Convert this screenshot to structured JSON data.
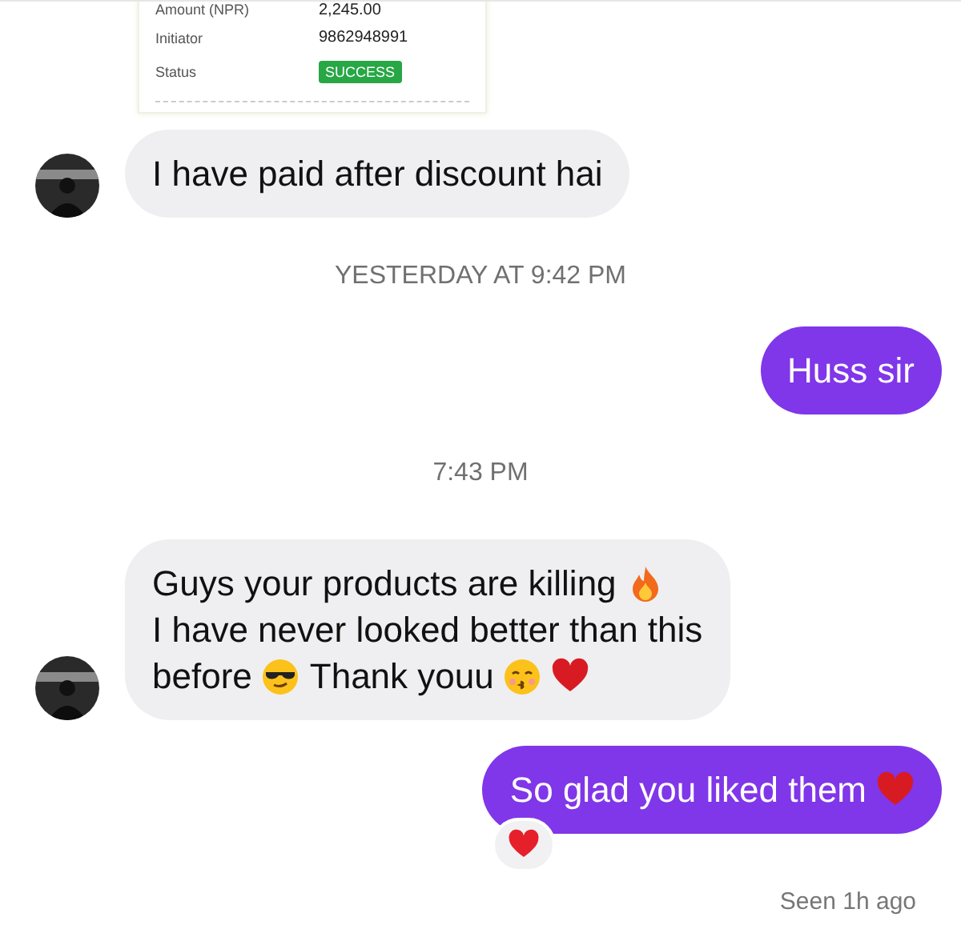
{
  "receipt": {
    "rows": [
      {
        "label": "Amount (NPR)",
        "value": "2,245.00",
        "kind": "text"
      },
      {
        "label": "Initiator",
        "value": "9862948991",
        "kind": "text"
      },
      {
        "label": "Status",
        "value": "SUCCESS",
        "kind": "badge"
      }
    ]
  },
  "thread": [
    {
      "kind": "incoming",
      "avatar": true,
      "lines": [
        [
          {
            "kind": "text",
            "text": "I have paid after discount hai"
          }
        ]
      ]
    },
    {
      "kind": "timestamp",
      "text": "YESTERDAY AT 9:42 PM"
    },
    {
      "kind": "outgoing",
      "lines": [
        [
          {
            "kind": "text",
            "text": "Huss sir"
          }
        ]
      ]
    },
    {
      "kind": "timestamp",
      "text": "7:43 PM"
    },
    {
      "kind": "incoming",
      "avatar": true,
      "lines": [
        [
          {
            "kind": "text",
            "text": "Guys your products are killing"
          },
          {
            "kind": "fire"
          }
        ],
        [
          {
            "kind": "text",
            "text": "I have never looked better than this"
          }
        ],
        [
          {
            "kind": "text",
            "text": "before"
          },
          {
            "kind": "cool"
          },
          {
            "kind": "text",
            "text": "Thank youu"
          },
          {
            "kind": "kiss"
          },
          {
            "kind": "heart"
          }
        ]
      ]
    },
    {
      "kind": "outgoing",
      "reacted": true,
      "lines": [
        [
          {
            "kind": "text",
            "text": "So glad you liked them"
          },
          {
            "kind": "heart"
          }
        ]
      ]
    }
  ],
  "status": "Seen 1h ago"
}
